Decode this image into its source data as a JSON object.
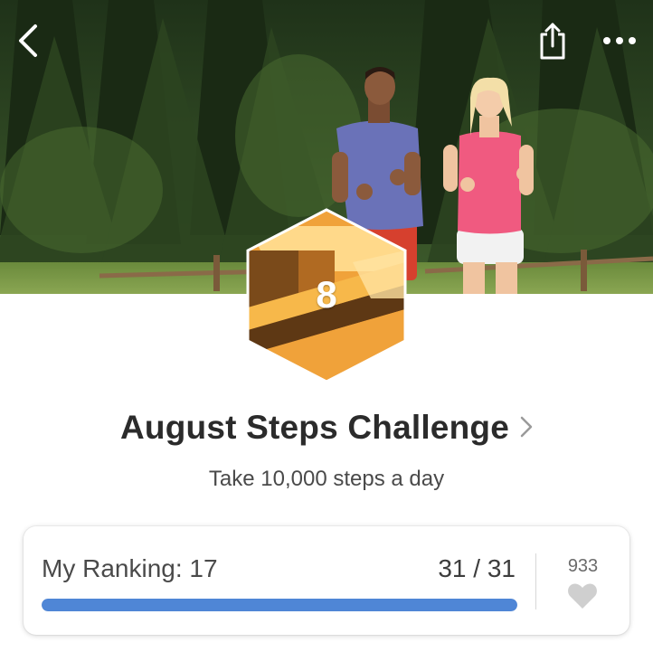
{
  "header": {
    "back_icon": "back-chevron-icon",
    "share_icon": "share-icon",
    "more_icon": "more-dots-icon"
  },
  "badge": {
    "number": "8",
    "icon": "hexagon-badge-icon",
    "colors": {
      "light": "#ffd98a",
      "mid": "#f0a23a",
      "dark": "#7a4a1a",
      "deep": "#5e3814"
    }
  },
  "challenge": {
    "title": "August Steps Challenge",
    "subtitle": "Take 10,000 steps a day"
  },
  "ranking": {
    "label": "My Ranking: 17",
    "progress_text": "31 / 31",
    "progress_fraction": 1.0,
    "progress_color": "#4f86d6",
    "likes": "933",
    "like_icon": "heart-icon"
  }
}
